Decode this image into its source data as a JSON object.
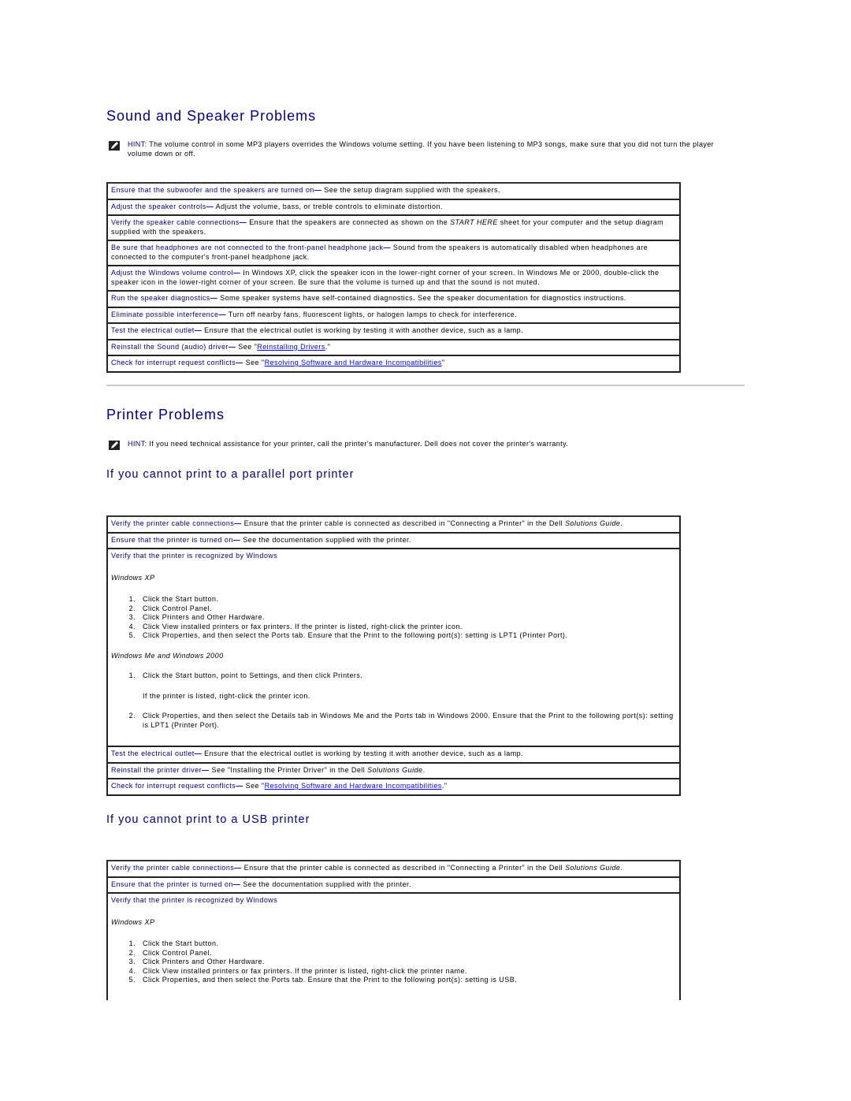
{
  "sound": {
    "title": "Sound and Speaker Problems",
    "hint": {
      "label": "HINT:",
      "text": " The volume control in some MP3 players overrides the Windows volume setting. If you have been listening to MP3 songs, make sure that you did not turn the player volume down or off."
    },
    "rows": [
      {
        "lead": "Ensure that the subwoofer and the speakers are turned on",
        "text": " See the setup diagram supplied with the speakers."
      },
      {
        "lead": "Adjust the speaker controls",
        "text": " Adjust the volume, bass, or treble controls to eliminate distortion."
      },
      {
        "lead": "Verify the speaker cable connections",
        "text_before": " Ensure that the speakers are connected as shown on the ",
        "italic": "START HERE",
        "text_after": " sheet for your computer and the setup diagram supplied with the speakers."
      },
      {
        "lead": "Be sure that headphones are not connected to the front-panel headphone jack",
        "text": " Sound from the speakers is automatically disabled when headphones are connected to the computer's front-panel headphone jack."
      },
      {
        "lead": "Adjust the Windows volume control",
        "text": " In Windows XP, click the speaker icon in the lower-right corner of your screen. In Windows Me or 2000, double-click the speaker icon in the lower-right corner of your screen. Be sure that the volume is turned up and that the sound is not muted."
      },
      {
        "lead": "Run the speaker diagnostics",
        "text": " Some speaker systems have self-contained diagnostics. See the speaker documentation for diagnostics instructions."
      },
      {
        "lead": "Eliminate possible interference",
        "text": " Turn off nearby fans, fluorescent lights, or halogen lamps to check for interference."
      },
      {
        "lead": "Test the electrical outlet",
        "text": " Ensure that the electrical outlet is working by testing it with another device, such as a lamp."
      },
      {
        "lead": "Reinstall the Sound (audio) driver",
        "text_before": " See \"",
        "link": "Reinstalling Drivers",
        "text_after": ".\""
      },
      {
        "lead": "Check for interrupt request conflicts",
        "text_before": " See \"",
        "link": "Resolving Software and Hardware Incompatibilities",
        "text_after": "\""
      }
    ]
  },
  "printer": {
    "title": "Printer Problems",
    "hint": {
      "label": "HINT:",
      "text": " If you need technical assistance for your printer, call the printer's manufacturer. Dell does not cover the printer's warranty."
    },
    "parallel": {
      "title": "If you cannot print to a parallel port printer",
      "row_cable": {
        "lead": "Verify the printer cable connections",
        "text_before": " Ensure that the printer cable is connected as described in \"Connecting a Printer\" in the Dell ",
        "italic": "Solutions Guide",
        "text_after": "."
      },
      "row_on": {
        "lead": "Ensure that the printer is turned on",
        "text": " See the documentation supplied with the printer."
      },
      "row_recognized": {
        "lead": "Verify that the printer is recognized by Windows",
        "xp_label": "Windows XP",
        "xp_steps": [
          "Click the Start button.",
          "Click Control Panel.",
          "Click Printers and Other Hardware.",
          "Click View installed printers or fax printers. If the printer is listed, right-click the printer icon.",
          "Click Properties, and then select the Ports tab. Ensure that the Print to the following port(s): setting is LPT1 (Printer Port)."
        ],
        "me_label": "Windows Me and Windows 2000",
        "me_step1": "Click the Start button, point to Settings, and then click Printers.",
        "me_note": "If the printer is listed, right-click the printer icon.",
        "me_step2": "Click Properties, and then select the Details tab in Windows Me and the Ports tab in Windows 2000. Ensure that the Print to the following port(s): setting is LPT1 (Printer Port)."
      },
      "row_outlet": {
        "lead": "Test the electrical outlet",
        "text": " Ensure that the electrical outlet is working by testing it with another device, such as a lamp."
      },
      "row_driver": {
        "lead": "Reinstall the printer driver",
        "text_before": " See \"Installing the Printer Driver\" in the Dell ",
        "italic": "Solutions Guide",
        "text_after": "."
      },
      "row_irq": {
        "lead": "Check for interrupt request conflicts",
        "text_before": " See \"",
        "link": "Resolving Software and Hardware Incompatibilities",
        "text_after": ".\""
      }
    },
    "usb": {
      "title": "If you cannot print to a USB printer",
      "row_cable": {
        "lead": "Verify the printer cable connections",
        "text_before": " Ensure that the printer cable is connected as described in \"Connecting a Printer\" in the Dell ",
        "italic": "Solutions Guide",
        "text_after": "."
      },
      "row_on": {
        "lead": "Ensure that the printer is turned on",
        "text": " See the documentation supplied with the printer."
      },
      "row_recognized": {
        "lead": "Verify that the printer is recognized by Windows",
        "xp_label": "Windows XP",
        "xp_steps": [
          "Click the Start button.",
          "Click Control Panel.",
          "Click Printers and Other Hardware.",
          "Click View installed printers or fax printers. If the printer is listed, right-click the printer name.",
          "Click Properties, and then select the Ports tab. Ensure that the Print to the following port(s): setting is USB."
        ]
      }
    }
  },
  "dash": "—",
  "colors": {
    "heading": "#000080",
    "lead": "#000080",
    "link": "#0000ee"
  }
}
